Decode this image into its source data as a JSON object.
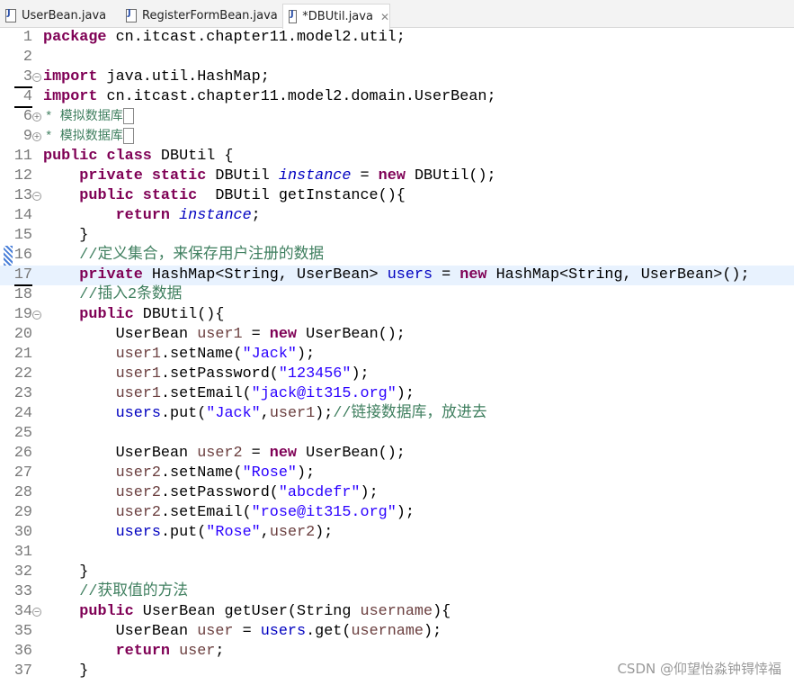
{
  "tabs": [
    {
      "label": "UserBean.java",
      "active": false
    },
    {
      "label": "RegisterFormBean.java",
      "active": false
    },
    {
      "label": "*DBUtil.java",
      "active": true
    }
  ],
  "highlight_line": "17",
  "lines": [
    {
      "n": "1",
      "seg": [
        [
          "k",
          "package"
        ],
        [
          "p",
          " cn.itcast.chapter11.model2.util;"
        ]
      ]
    },
    {
      "n": "2",
      "seg": []
    },
    {
      "n": "3",
      "fold": "minus",
      "seg": [
        [
          "k",
          "import"
        ],
        [
          "p",
          " java.util.HashMap;"
        ]
      ]
    },
    {
      "n": "4",
      "seg": [
        [
          "k",
          "import"
        ],
        [
          "p",
          " cn.itcast.chapter11.model2.domain.UserBean;"
        ]
      ]
    },
    {
      "n": "6",
      "fold": "plus",
      "folded": "* 模拟数据库"
    },
    {
      "n": "9",
      "fold": "plus",
      "folded": "* 模拟数据库"
    },
    {
      "n": "11",
      "seg": [
        [
          "k",
          "public class"
        ],
        [
          "p",
          " DBUtil {"
        ]
      ]
    },
    {
      "n": "12",
      "seg": [
        [
          "p",
          "    "
        ],
        [
          "k",
          "private static"
        ],
        [
          "p",
          " DBUtil "
        ],
        [
          "fi",
          "instance"
        ],
        [
          "p",
          " = "
        ],
        [
          "k",
          "new"
        ],
        [
          "p",
          " DBUtil();"
        ]
      ]
    },
    {
      "n": "13",
      "fold": "minus",
      "seg": [
        [
          "p",
          "    "
        ],
        [
          "k",
          "public static"
        ],
        [
          "p",
          "  DBUtil getInstance(){"
        ]
      ]
    },
    {
      "n": "14",
      "seg": [
        [
          "p",
          "        "
        ],
        [
          "k",
          "return"
        ],
        [
          "p",
          " "
        ],
        [
          "fi",
          "instance"
        ],
        [
          "p",
          ";"
        ]
      ]
    },
    {
      "n": "15",
      "seg": [
        [
          "p",
          "    }"
        ]
      ]
    },
    {
      "n": "16",
      "seg": [
        [
          "p",
          "    "
        ],
        [
          "c",
          "//定义集合，来保存用户注册的数据"
        ]
      ]
    },
    {
      "n": "17",
      "seg": [
        [
          "p",
          "    "
        ],
        [
          "k",
          "private"
        ],
        [
          "p",
          " HashMap<String, UserBean> "
        ],
        [
          "f",
          "users"
        ],
        [
          "p",
          " = "
        ],
        [
          "k",
          "new"
        ],
        [
          "p",
          " HashMap<String, UserBean>();"
        ]
      ]
    },
    {
      "n": "18",
      "seg": [
        [
          "p",
          "    "
        ],
        [
          "c",
          "//插入2条数据"
        ]
      ]
    },
    {
      "n": "19",
      "fold": "minus",
      "seg": [
        [
          "p",
          "    "
        ],
        [
          "k",
          "public"
        ],
        [
          "p",
          " DBUtil(){"
        ]
      ]
    },
    {
      "n": "20",
      "seg": [
        [
          "p",
          "        UserBean "
        ],
        [
          "v",
          "user1"
        ],
        [
          "p",
          " = "
        ],
        [
          "k",
          "new"
        ],
        [
          "p",
          " UserBean();"
        ]
      ]
    },
    {
      "n": "21",
      "seg": [
        [
          "p",
          "        "
        ],
        [
          "v",
          "user1"
        ],
        [
          "p",
          ".setName("
        ],
        [
          "s",
          "\"Jack\""
        ],
        [
          "p",
          ");"
        ]
      ]
    },
    {
      "n": "22",
      "seg": [
        [
          "p",
          "        "
        ],
        [
          "v",
          "user1"
        ],
        [
          "p",
          ".setPassword("
        ],
        [
          "s",
          "\"123456\""
        ],
        [
          "p",
          ");"
        ]
      ]
    },
    {
      "n": "23",
      "seg": [
        [
          "p",
          "        "
        ],
        [
          "v",
          "user1"
        ],
        [
          "p",
          ".setEmail("
        ],
        [
          "s",
          "\"jack@it315.org\""
        ],
        [
          "p",
          ");"
        ]
      ]
    },
    {
      "n": "24",
      "seg": [
        [
          "p",
          "        "
        ],
        [
          "f",
          "users"
        ],
        [
          "p",
          ".put("
        ],
        [
          "s",
          "\"Jack\""
        ],
        [
          "p",
          ","
        ],
        [
          "v",
          "user1"
        ],
        [
          "p",
          ");"
        ],
        [
          "c",
          "//链接数据库，放进去"
        ]
      ]
    },
    {
      "n": "25",
      "seg": []
    },
    {
      "n": "26",
      "seg": [
        [
          "p",
          "        UserBean "
        ],
        [
          "v",
          "user2"
        ],
        [
          "p",
          " = "
        ],
        [
          "k",
          "new"
        ],
        [
          "p",
          " UserBean();"
        ]
      ]
    },
    {
      "n": "27",
      "seg": [
        [
          "p",
          "        "
        ],
        [
          "v",
          "user2"
        ],
        [
          "p",
          ".setName("
        ],
        [
          "s",
          "\"Rose\""
        ],
        [
          "p",
          ");"
        ]
      ]
    },
    {
      "n": "28",
      "seg": [
        [
          "p",
          "        "
        ],
        [
          "v",
          "user2"
        ],
        [
          "p",
          ".setPassword("
        ],
        [
          "s",
          "\"abcdefr\""
        ],
        [
          "p",
          ");"
        ]
      ]
    },
    {
      "n": "29",
      "seg": [
        [
          "p",
          "        "
        ],
        [
          "v",
          "user2"
        ],
        [
          "p",
          ".setEmail("
        ],
        [
          "s",
          "\"rose@it315.org\""
        ],
        [
          "p",
          ");"
        ]
      ]
    },
    {
      "n": "30",
      "seg": [
        [
          "p",
          "        "
        ],
        [
          "f",
          "users"
        ],
        [
          "p",
          ".put("
        ],
        [
          "s",
          "\"Rose\""
        ],
        [
          "p",
          ","
        ],
        [
          "v",
          "user2"
        ],
        [
          "p",
          ");"
        ]
      ]
    },
    {
      "n": "31",
      "seg": []
    },
    {
      "n": "32",
      "seg": [
        [
          "p",
          "    }"
        ]
      ]
    },
    {
      "n": "33",
      "seg": [
        [
          "p",
          "    "
        ],
        [
          "c",
          "//获取值的方法"
        ]
      ]
    },
    {
      "n": "34",
      "fold": "minus",
      "seg": [
        [
          "p",
          "    "
        ],
        [
          "k",
          "public"
        ],
        [
          "p",
          " UserBean getUser(String "
        ],
        [
          "v",
          "username"
        ],
        [
          "p",
          "){"
        ]
      ]
    },
    {
      "n": "35",
      "seg": [
        [
          "p",
          "        UserBean "
        ],
        [
          "v",
          "user"
        ],
        [
          "p",
          " = "
        ],
        [
          "f",
          "users"
        ],
        [
          "p",
          ".get("
        ],
        [
          "v",
          "username"
        ],
        [
          "p",
          ");"
        ]
      ]
    },
    {
      "n": "36",
      "seg": [
        [
          "p",
          "        "
        ],
        [
          "k",
          "return"
        ],
        [
          "p",
          " "
        ],
        [
          "v",
          "user"
        ],
        [
          "p",
          ";"
        ]
      ]
    },
    {
      "n": "37",
      "seg": [
        [
          "p",
          "    }"
        ]
      ]
    }
  ],
  "watermark": "CSDN @仰望怡淼钟锝悻福"
}
